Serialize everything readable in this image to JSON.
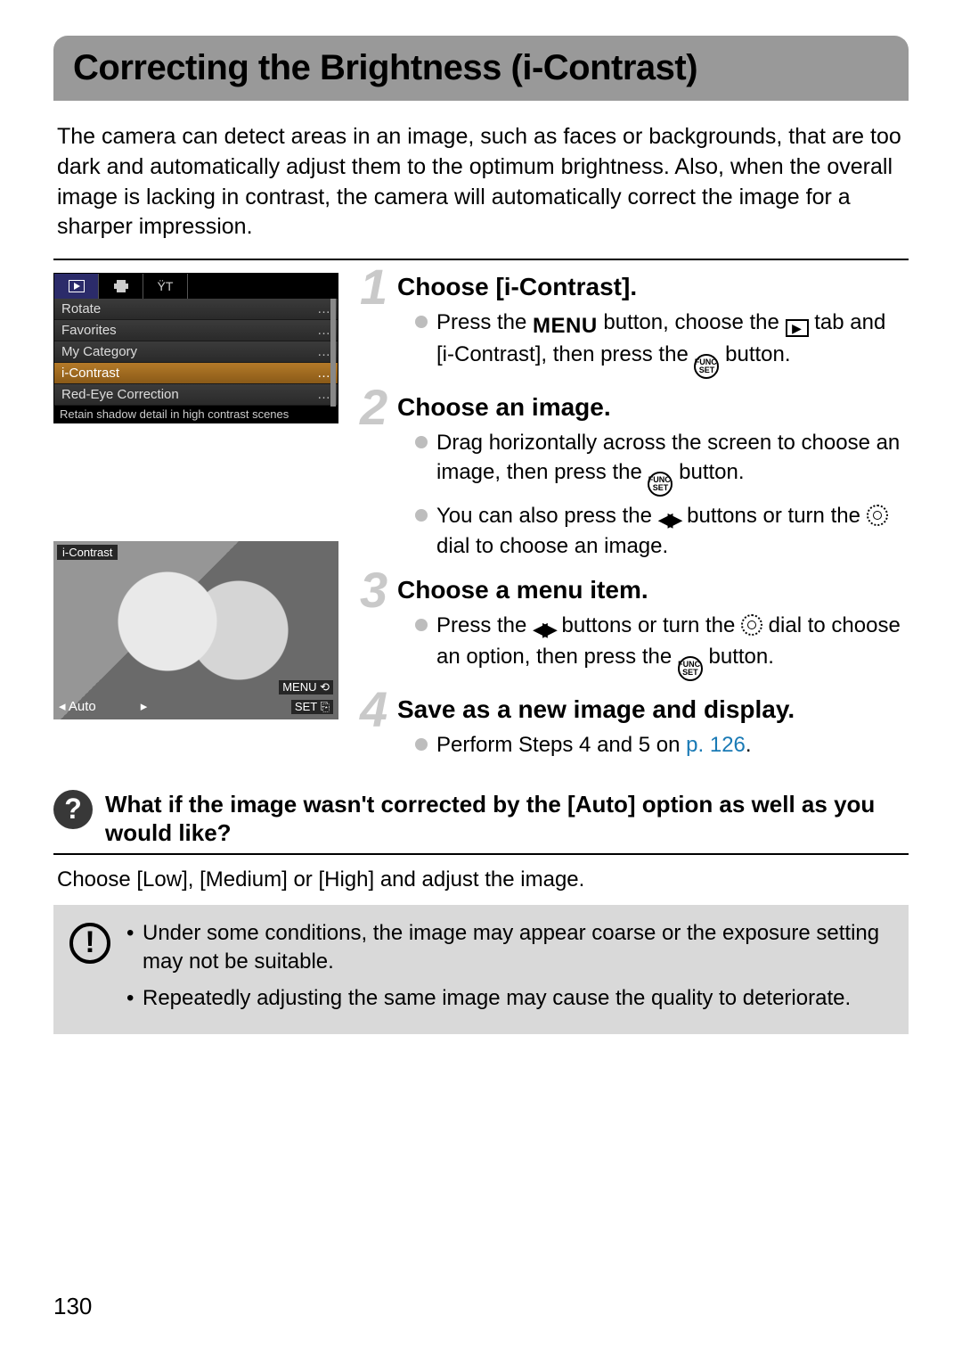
{
  "header": {
    "title": "Correcting the Brightness (i-Contrast)"
  },
  "intro": "The camera can detect areas in an image, such as faces or backgrounds, that are too dark and automatically adjust them to the optimum brightness. Also, when the overall image is lacking in contrast, the camera will automatically correct the image for a sharper impression.",
  "cam_menu": {
    "rows": [
      "Rotate",
      "Favorites",
      "My Category",
      "i-Contrast",
      "Red-Eye Correction"
    ],
    "hint": "Retain shadow detail in high contrast scenes"
  },
  "sample": {
    "tag": "i-Contrast",
    "menu_label": "MENU",
    "set_label": "SET",
    "auto": "Auto"
  },
  "steps": [
    {
      "num": "1",
      "title": "Choose [i-Contrast].",
      "bullets": [
        {
          "pre": "Press the ",
          "ic1": "MENU",
          "mid1": " button, choose the ",
          "ic2": "PLAY",
          "mid2": " tab and [i-Contrast], then press the ",
          "ic3": "FUNC",
          "post": " button."
        }
      ]
    },
    {
      "num": "2",
      "title": "Choose an image.",
      "bullets": [
        {
          "pre": "Drag horizontally across the screen to choose an image, then press the ",
          "ic1": "FUNC",
          "post": " button."
        },
        {
          "pre": "You can also press the ",
          "ic1": "LR",
          "mid1": " buttons or turn the ",
          "ic2": "DIAL",
          "post": " dial to choose an image."
        }
      ]
    },
    {
      "num": "3",
      "title": "Choose a menu item.",
      "bullets": [
        {
          "pre": "Press the ",
          "ic1": "LR",
          "mid1": " buttons or turn the ",
          "ic2": "DIAL",
          "mid2": " dial to choose an option, then press the ",
          "ic3": "FUNC",
          "post": " button."
        }
      ]
    },
    {
      "num": "4",
      "title": "Save as a new image and display.",
      "bullets": [
        {
          "pre": "Perform Steps 4 and 5 on ",
          "link": "p. 126",
          "post": "."
        }
      ]
    }
  ],
  "qa": {
    "question": "What if the image wasn't corrected by the [Auto] option as well as you would like?",
    "answer": "Choose [Low], [Medium] or [High] and adjust the image."
  },
  "caution": [
    "Under some conditions, the image may appear coarse or the exposure setting may not be suitable.",
    "Repeatedly adjusting the same image may cause the quality to deteriorate."
  ],
  "page_number": "130"
}
